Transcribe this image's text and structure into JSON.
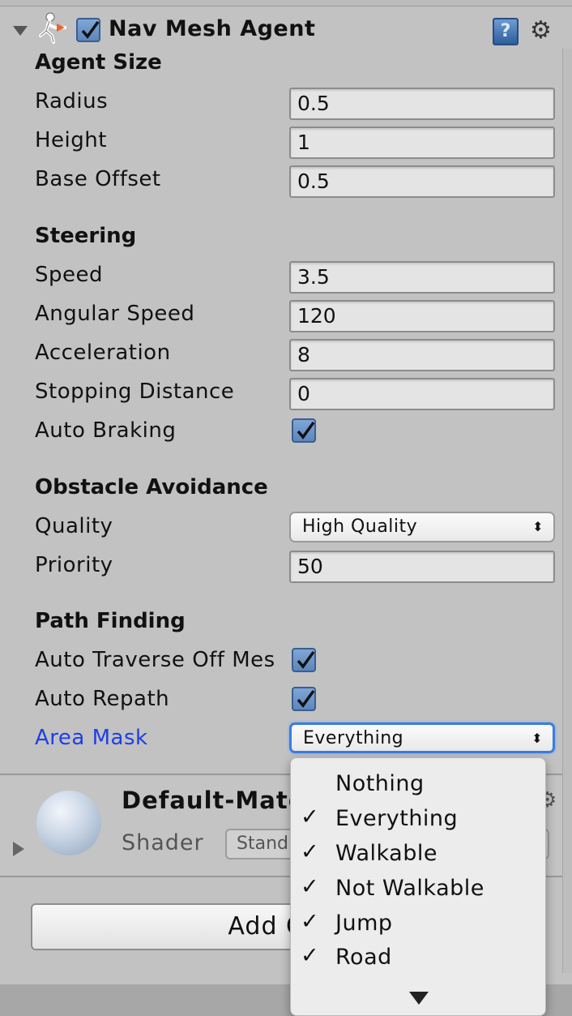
{
  "component": {
    "title": "Nav Mesh Agent",
    "enabled": true
  },
  "agent_size": {
    "heading": "Agent Size",
    "radius": {
      "label": "Radius",
      "value": "0.5"
    },
    "height": {
      "label": "Height",
      "value": "1"
    },
    "base_offset": {
      "label": "Base Offset",
      "value": "0.5"
    }
  },
  "steering": {
    "heading": "Steering",
    "speed": {
      "label": "Speed",
      "value": "3.5"
    },
    "angular_speed": {
      "label": "Angular Speed",
      "value": "120"
    },
    "acceleration": {
      "label": "Acceleration",
      "value": "8"
    },
    "stopping_distance": {
      "label": "Stopping Distance",
      "value": "0"
    },
    "auto_braking": {
      "label": "Auto Braking",
      "checked": true
    }
  },
  "obstacle_avoidance": {
    "heading": "Obstacle Avoidance",
    "quality": {
      "label": "Quality",
      "value": "High Quality"
    },
    "priority": {
      "label": "Priority",
      "value": "50"
    }
  },
  "path_finding": {
    "heading": "Path Finding",
    "auto_traverse": {
      "label": "Auto Traverse Off Mes",
      "checked": true
    },
    "auto_repath": {
      "label": "Auto Repath",
      "checked": true
    },
    "area_mask": {
      "label": "Area Mask",
      "value": "Everything"
    }
  },
  "area_mask_menu": {
    "items": [
      {
        "label": "Nothing",
        "checked": false
      },
      {
        "label": "Everything",
        "checked": true
      },
      {
        "label": "Walkable",
        "checked": true
      },
      {
        "label": "Not Walkable",
        "checked": true
      },
      {
        "label": "Jump",
        "checked": true
      },
      {
        "label": "Road",
        "checked": true
      }
    ],
    "check_glyph": "✓"
  },
  "material": {
    "name": "Default-Mater",
    "shader_label": "Shader",
    "shader_value": "Stand"
  },
  "add_component": {
    "label": "Add Com"
  },
  "icons": {
    "help": "?",
    "gear": "⚙",
    "updown": "⬍"
  },
  "colors": {
    "accent_blue": "#1d3fe6",
    "checkbox_blue": "#6a93c9"
  }
}
